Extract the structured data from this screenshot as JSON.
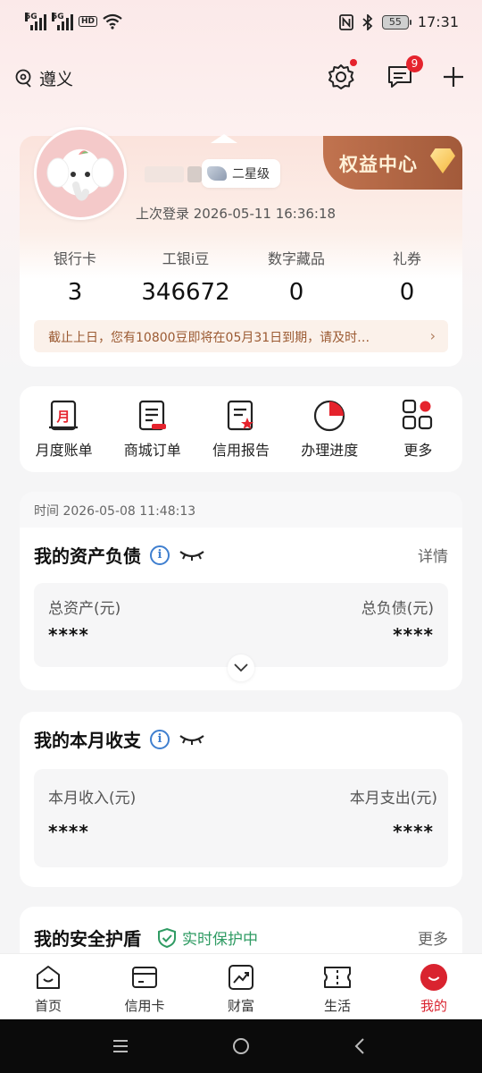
{
  "status_bar": {
    "sim1": "5G",
    "sim2": "5G",
    "hd": "HD",
    "battery": "55",
    "time": "17:31"
  },
  "header": {
    "location": "遵义",
    "messages_badge": "9"
  },
  "profile": {
    "level": "二星级",
    "equity_center": "权益中心",
    "last_login": "上次登录 2026-05-11 16:36:18",
    "stats": [
      {
        "label": "银行卡",
        "value": "3"
      },
      {
        "label": "工银i豆",
        "value": "346672"
      },
      {
        "label": "数字藏品",
        "value": "0"
      },
      {
        "label": "礼券",
        "value": "0"
      }
    ],
    "notice": "截止上日，您有10800豆即将在05月31日到期，请及时…"
  },
  "quick_actions": [
    {
      "label": "月度账单",
      "icon": "monthly-bill-icon"
    },
    {
      "label": "商城订单",
      "icon": "mall-order-icon"
    },
    {
      "label": "信用报告",
      "icon": "credit-report-icon"
    },
    {
      "label": "办理进度",
      "icon": "progress-icon"
    },
    {
      "label": "更多",
      "icon": "more-grid-icon"
    }
  ],
  "assets": {
    "time": "时间 2026-05-08 11:48:13",
    "title": "我的资产负债",
    "detail": "详情",
    "total_assets_label": "总资产(元)",
    "total_assets_value": "****",
    "total_liabilities_label": "总负债(元)",
    "total_liabilities_value": "****"
  },
  "monthly": {
    "title": "我的本月收支",
    "income_label": "本月收入(元)",
    "income_value": "****",
    "expense_label": "本月支出(元)",
    "expense_value": "****"
  },
  "security": {
    "title": "我的安全护盾",
    "status": "实时保护中",
    "more": "更多"
  },
  "bottom_nav": [
    {
      "label": "首页",
      "icon": "home-icon"
    },
    {
      "label": "信用卡",
      "icon": "credit-card-icon"
    },
    {
      "label": "财富",
      "icon": "wealth-icon"
    },
    {
      "label": "生活",
      "icon": "life-ticket-icon"
    },
    {
      "label": "我的",
      "icon": "mine-icon",
      "active": true
    }
  ],
  "colors": {
    "brand_red": "#d9232f",
    "badge_red": "#e5232d",
    "info_blue": "#3f7fcf",
    "shield_green": "#2f9b63",
    "equity_brown": "#a25a3a"
  }
}
